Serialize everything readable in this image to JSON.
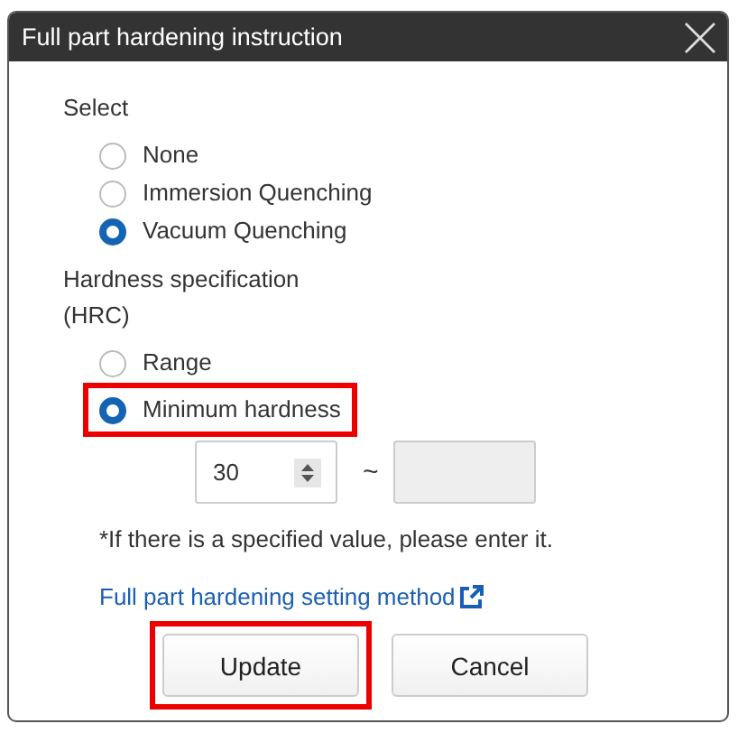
{
  "window": {
    "title": "Full part hardening instruction"
  },
  "select": {
    "label": "Select",
    "options": [
      {
        "label": "None",
        "selected": false,
        "highlighted": false
      },
      {
        "label": "Immersion Quenching",
        "selected": false,
        "highlighted": false
      },
      {
        "label": "Vacuum Quenching",
        "selected": true,
        "highlighted": false
      }
    ]
  },
  "hardness": {
    "label": "Hardness specification",
    "unit": "(HRC)",
    "options": [
      {
        "label": "Range",
        "selected": false,
        "highlighted": false
      },
      {
        "label": "Minimum hardness",
        "selected": true,
        "highlighted": true
      }
    ],
    "min_value": "30",
    "separator": "~",
    "max_disabled": true
  },
  "note": "*If there is a specified value, please enter it.",
  "link": "Full part hardening setting method",
  "buttons": [
    {
      "label": "Update",
      "highlighted": true
    },
    {
      "label": "Cancel",
      "highlighted": false
    }
  ]
}
